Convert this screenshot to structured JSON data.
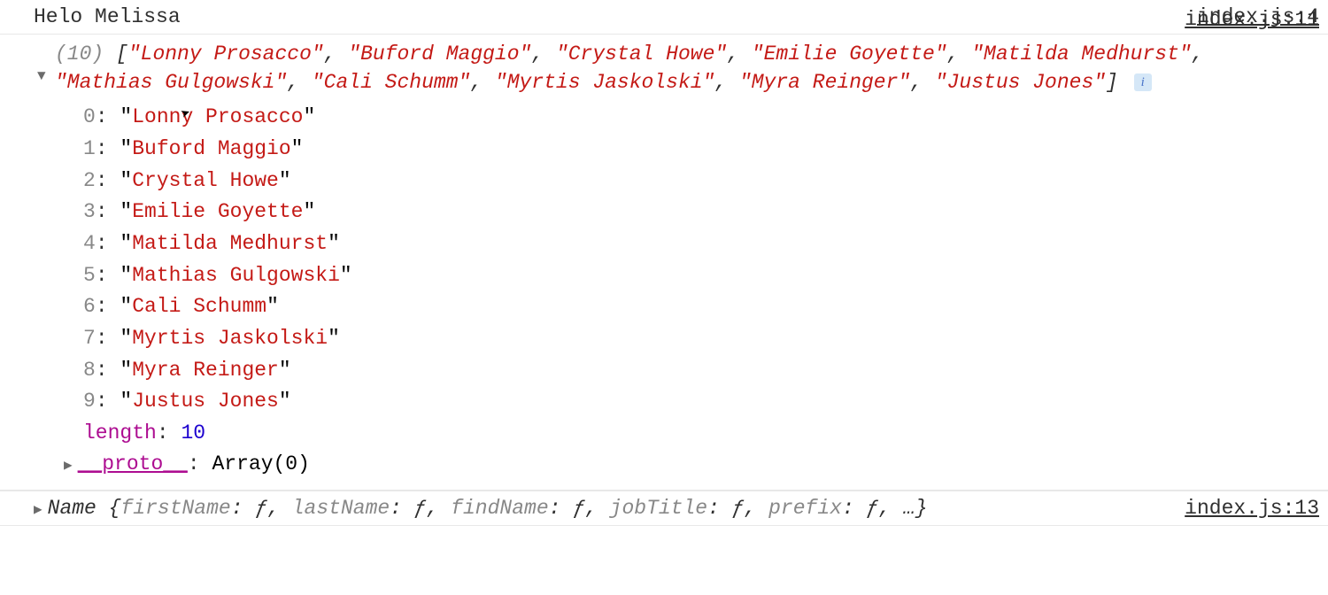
{
  "log1": {
    "message": "Helo Melissa",
    "source": "index.js:4"
  },
  "log2": {
    "source": "index.js:11",
    "array_count": "(10)",
    "open_bracket": "[",
    "close_bracket": "]",
    "items": [
      "Lonny Prosacco",
      "Buford Maggio",
      "Crystal Howe",
      "Emilie Goyette",
      "Matilda Medhurst",
      "Mathias Gulgowski",
      "Cali Schumm",
      "Myrtis Jaskolski",
      "Myra Reinger",
      "Justus Jones"
    ],
    "length_key": "length",
    "length_val": "10",
    "proto_key": "__proto__",
    "proto_val": "Array(0)"
  },
  "log3": {
    "source": "index.js:13",
    "object_name": "Name",
    "brace_open": "{",
    "brace_close": ", …}",
    "props": [
      {
        "k": "firstName",
        "v": "ƒ"
      },
      {
        "k": "lastName",
        "v": "ƒ"
      },
      {
        "k": "findName",
        "v": "ƒ"
      },
      {
        "k": "jobTitle",
        "v": "ƒ"
      },
      {
        "k": "prefix",
        "v": "ƒ"
      }
    ]
  },
  "glyphs": {
    "tri_right": "▶",
    "tri_down": "▼",
    "info": "i"
  }
}
